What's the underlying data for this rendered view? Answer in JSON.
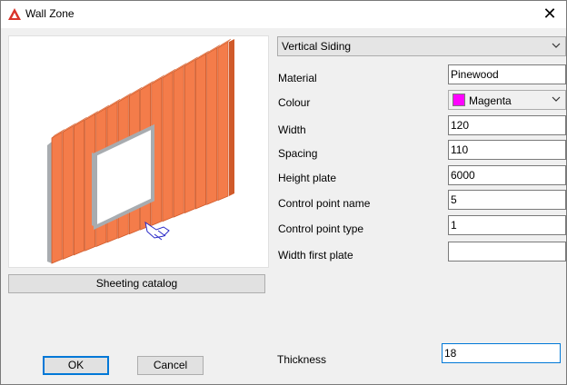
{
  "window": {
    "title": "Wall Zone",
    "close_glyph": "✕"
  },
  "icons": {
    "app": "app-logo-icon",
    "close": "close-icon",
    "chevron": "chevron-down-icon",
    "cursor": "pointer-cursor-icon"
  },
  "colors": {
    "wall_main": "#f47c4a",
    "wall_dark": "#d05a2a",
    "frame": "#a8acb0",
    "accent": "#0078d7",
    "swatch": "#ff00ff"
  },
  "type_select": {
    "value": "Vertical Siding"
  },
  "form": {
    "material_label": "Material",
    "material_value": "Pinewood",
    "colour_label": "Colour",
    "colour_value": "Magenta",
    "width_label": "Width",
    "width_value": "120",
    "spacing_label": "Spacing",
    "spacing_value": "110",
    "height_label": "Height plate",
    "height_value": "6000",
    "cp_name_label": "Control point name",
    "cp_name_value": "5",
    "cp_type_label": "Control point type",
    "cp_type_value": "1",
    "width_first_label": "Width first plate",
    "width_first_value": "",
    "thickness_label": "Thickness",
    "thickness_value": "18"
  },
  "buttons": {
    "catalog": "Sheeting catalog",
    "ok": "OK",
    "cancel": "Cancel"
  }
}
